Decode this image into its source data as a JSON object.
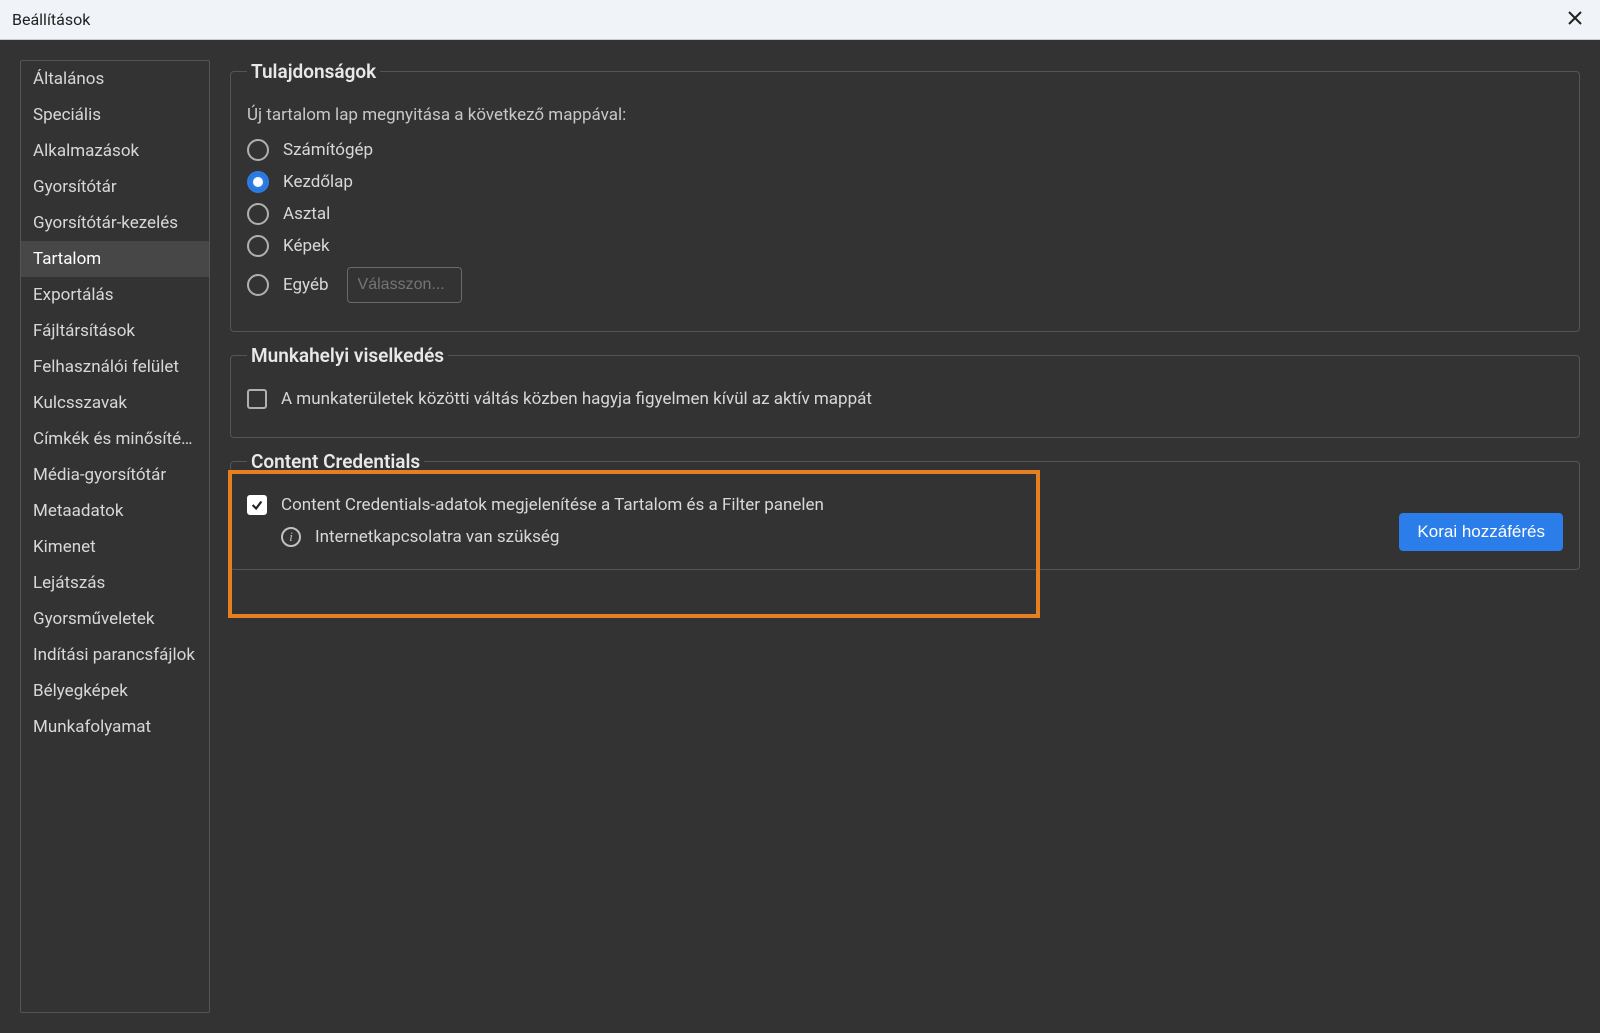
{
  "titlebar": {
    "title": "Beállítások"
  },
  "sidebar": {
    "items": [
      {
        "label": "Általános"
      },
      {
        "label": "Speciális"
      },
      {
        "label": "Alkalmazások"
      },
      {
        "label": "Gyorsítótár"
      },
      {
        "label": "Gyorsítótár-kezelés"
      },
      {
        "label": "Tartalom",
        "selected": true
      },
      {
        "label": "Exportálás"
      },
      {
        "label": "Fájltársítások"
      },
      {
        "label": "Felhasználói felület"
      },
      {
        "label": "Kulcsszavak"
      },
      {
        "label": "Címkék és minősítések"
      },
      {
        "label": "Média-gyorsítótár"
      },
      {
        "label": "Metaadatok"
      },
      {
        "label": "Kimenet"
      },
      {
        "label": "Lejátszás"
      },
      {
        "label": "Gyorsműveletek"
      },
      {
        "label": "Indítási parancsfájlok"
      },
      {
        "label": "Bélyegképek"
      },
      {
        "label": "Munkafolyamat"
      }
    ]
  },
  "properties": {
    "legend": "Tulajdonságok",
    "description": "Új tartalom lap megnyitása a következő mappával:",
    "options": [
      {
        "label": "Számítógép",
        "selected": false
      },
      {
        "label": "Kezdőlap",
        "selected": true
      },
      {
        "label": "Asztal",
        "selected": false
      },
      {
        "label": "Képek",
        "selected": false
      },
      {
        "label": "Egyéb",
        "selected": false,
        "hasInput": true,
        "placeholder": "Válasszon..."
      }
    ]
  },
  "workplace": {
    "legend": "Munkahelyi viselkedés",
    "checkbox_label": "A munkaterületek közötti váltás közben hagyja figyelmen kívül az aktív mappát",
    "checked": false
  },
  "cc": {
    "legend": "Content Credentials",
    "checkbox_label": "Content Credentials-adatok megjelenítése a Tartalom és a Filter panelen",
    "checked": true,
    "info_text": "Internetkapcsolatra van szükség",
    "button_label": "Korai hozzáférés"
  }
}
